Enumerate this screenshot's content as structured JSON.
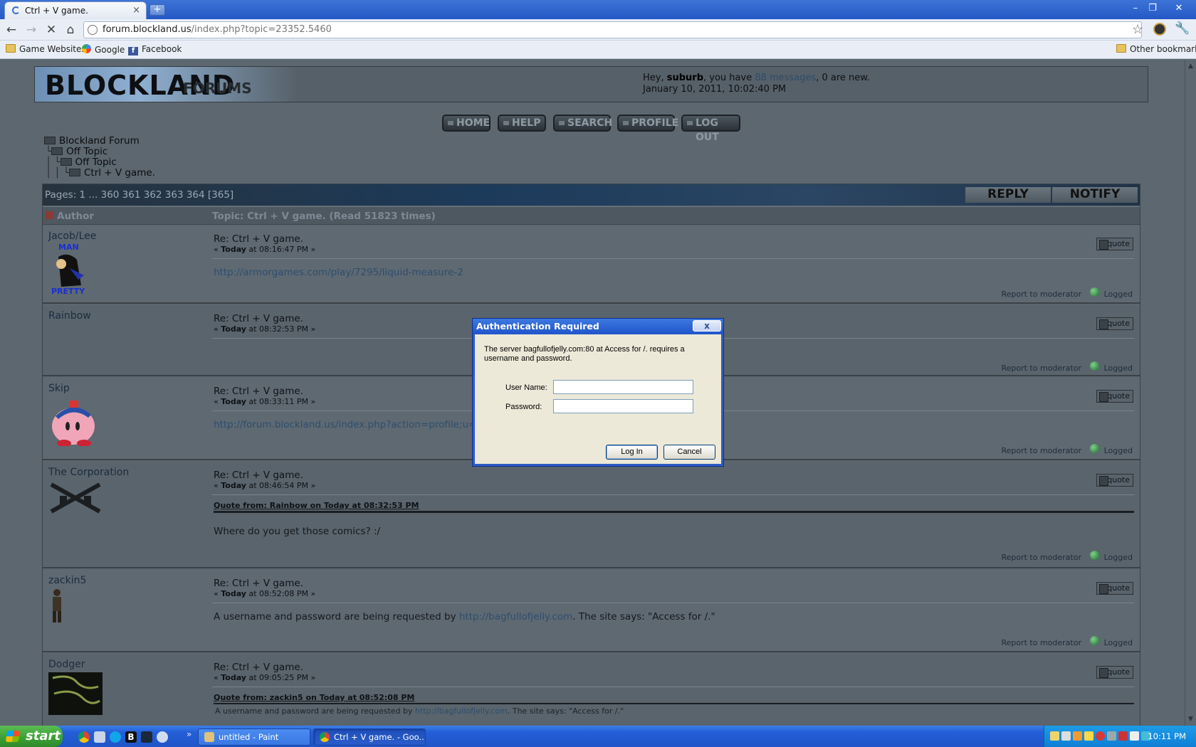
{
  "browser": {
    "tab_title": "Ctrl + V game.",
    "tab_close": "×",
    "new_tab": "+",
    "url_host": "forum.blockland.us",
    "url_path": "/index.php?topic=23352.5460",
    "bookmarks": [
      "Game Websites",
      "Google",
      "Facebook"
    ],
    "other_bookmarks": "Other bookmarks"
  },
  "forum": {
    "logo_big": "BLOCKLAND",
    "logo_small": "FORUMS",
    "greeting_prefix": "Hey, ",
    "username": "suburb",
    "greeting_mid": ", you have ",
    "messages_link": "88 messages",
    "greeting_suffix": ", 0 are new.",
    "datetime": "January 10, 2011, 10:02:40 PM",
    "menu": [
      "HOME",
      "HELP",
      "SEARCH",
      "PROFILE",
      "LOG OUT"
    ],
    "linktree": [
      "Blockland Forum",
      "Off Topic",
      "Off Topic",
      "Ctrl + V game."
    ],
    "pages": "Pages: 1 ... 360 361 362 363 364 [365]",
    "reply_label": "REPLY",
    "notify_label": "NOTIFY",
    "author_header": "Author",
    "topic_header": "Topic: Ctrl + V game.  (Read 51823 times)"
  },
  "posts": [
    {
      "author": "Jacob/Lee",
      "subject": "Re: Ctrl + V game.",
      "meta_pre": "« ",
      "meta_day": "Today",
      "meta_time": " at 08:16:47 PM »",
      "body": "http://armorgames.com/play/7295/liquid-measure-2"
    },
    {
      "author": "Rainbow",
      "subject": "Re: Ctrl + V game.",
      "meta_pre": "« ",
      "meta_day": "Today",
      "meta_time": " at 08:32:53 PM »",
      "body": ""
    },
    {
      "author": "Skip",
      "subject": "Re: Ctrl + V game.",
      "meta_pre": "« ",
      "meta_day": "Today",
      "meta_time": " at 08:33:11 PM »",
      "body": "http://forum.blockland.us/index.php?action=profile;u=3"
    },
    {
      "author": "The Corporation",
      "subject": "Re: Ctrl + V game.",
      "meta_pre": "« ",
      "meta_day": "Today",
      "meta_time": " at 08:46:54 PM »",
      "quote_head": "Quote from: Rainbow on Today at 08:32:53 PM",
      "body": "Where do you get those comics? :/"
    },
    {
      "author": "zackin5",
      "subject": "Re: Ctrl + V game.",
      "meta_pre": "« ",
      "meta_day": "Today",
      "meta_time": " at 08:52:08 PM »",
      "body_pre": "A username and password are being requested by ",
      "body_link": "http://bagfullofjelly.com",
      "body_post": ". The site says: \"Access for /.\""
    },
    {
      "author": "Dodger",
      "subject": "Re: Ctrl + V game.",
      "meta_pre": "« ",
      "meta_day": "Today",
      "meta_time": " at 09:05:25 PM »",
      "quote_head": "Quote from: zackin5 on Today at 08:52:08 PM",
      "quote_pre": "A username and password are being requested by ",
      "quote_link": "http://bagfullofjelly.com",
      "quote_post": ". The site says: \"Access for /.\""
    }
  ],
  "post_actions": {
    "quote": "quote",
    "report": "Report to moderator",
    "logged": "Logged"
  },
  "dialog": {
    "title": "Authentication Required",
    "close": "x",
    "message": "The server bagfullofjelly.com:80 at Access for /. requires a username and password.",
    "username_label": "User Name:",
    "password_label": "Password:",
    "username_value": "",
    "password_value": "",
    "login_label": "Log In",
    "cancel_label": "Cancel"
  },
  "taskbar": {
    "start": "start",
    "tasks": [
      "untitled - Paint",
      "Ctrl + V game. - Goo..."
    ],
    "clock": "10:11 PM",
    "expand": "»"
  }
}
